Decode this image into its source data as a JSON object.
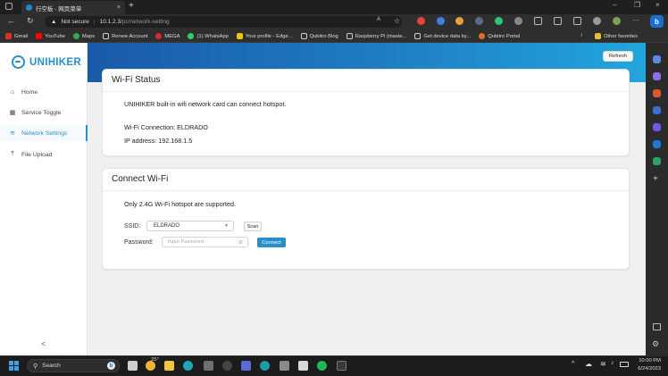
{
  "browser": {
    "tab_title": "行空板 - 网页菜单",
    "close_tab": "×",
    "new_tab": "+",
    "window_controls": [
      "–",
      "❐",
      "×"
    ],
    "security_label": "Not secure",
    "url_host": "10.1.2.3",
    "url_path": "/pc/network-setting",
    "bookmarks": [
      {
        "label": "Gmail",
        "color": "#d93025"
      },
      {
        "label": "YouTube",
        "color": "#ff0000"
      },
      {
        "label": "Maps",
        "color": "#34a853"
      },
      {
        "label": "Renew Account",
        "color": "#cfcfcf"
      },
      {
        "label": "MEGA",
        "color": "#d9272e"
      },
      {
        "label": "(1) WhatsApp",
        "color": "#25d366"
      },
      {
        "label": "Your profile - Edge...",
        "color": "#f5c400"
      },
      {
        "label": "Qubitro Blog",
        "color": "#cfcfcf"
      },
      {
        "label": "Raspberry Pi (maste...",
        "color": "#cfcfcf"
      },
      {
        "label": "Get device data by...",
        "color": "#cfcfcf"
      },
      {
        "label": "Qubitro Portal",
        "color": "#e36b2c"
      }
    ],
    "other_favorites": "Other favorites"
  },
  "app": {
    "logo_text": "UNIHIKER",
    "nav": [
      {
        "label": "Home",
        "icon": "home-icon",
        "active": false
      },
      {
        "label": "Service Toggle",
        "icon": "grid-icon",
        "active": false
      },
      {
        "label": "Network Settings",
        "icon": "wifi-icon",
        "active": true
      },
      {
        "label": "File Upload",
        "icon": "upload-icon",
        "active": false
      }
    ],
    "collapse_glyph": "<",
    "refresh_label": "Refresh",
    "accent_color": "#2a8fc9"
  },
  "wifi_status": {
    "title": "Wi-Fi Status",
    "description": "UNIHIKER built-in wifi network card can connect hotspot.",
    "connection": "Wi-Fi Connection: ELDRADO",
    "ip": "IP address: 192.168.1.5"
  },
  "connect_wifi": {
    "title": "Connect Wi-Fi",
    "note": "Only 2.4G Wi-Fi hotspot are supported.",
    "ssid_label": "SSID:",
    "ssid_value": "ELDRADO",
    "scan_label": "Scan",
    "password_label": "Password:",
    "password_placeholder": "Input Password",
    "connect_label": "Connect"
  },
  "taskbar": {
    "search_label": "Search",
    "weather_temp": "25°",
    "time": "10:00 PM",
    "date": "6/24/2023"
  }
}
